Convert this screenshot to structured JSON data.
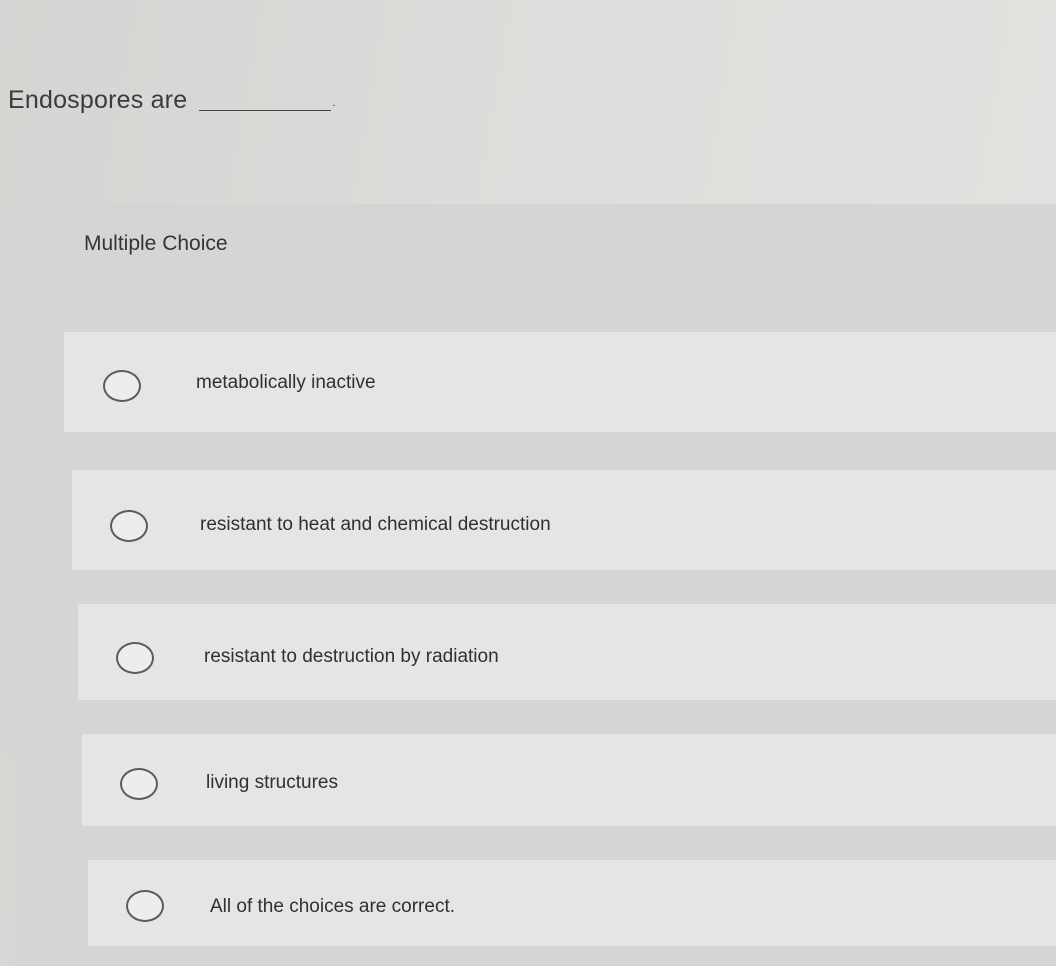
{
  "question": {
    "text": "Endospores are",
    "blank_end": "."
  },
  "multiple_choice": {
    "header": "Multiple Choice",
    "options": [
      "metabolically inactive",
      "resistant to heat and chemical destruction",
      "resistant to destruction by radiation",
      "living structures",
      "All of the choices are correct."
    ]
  }
}
